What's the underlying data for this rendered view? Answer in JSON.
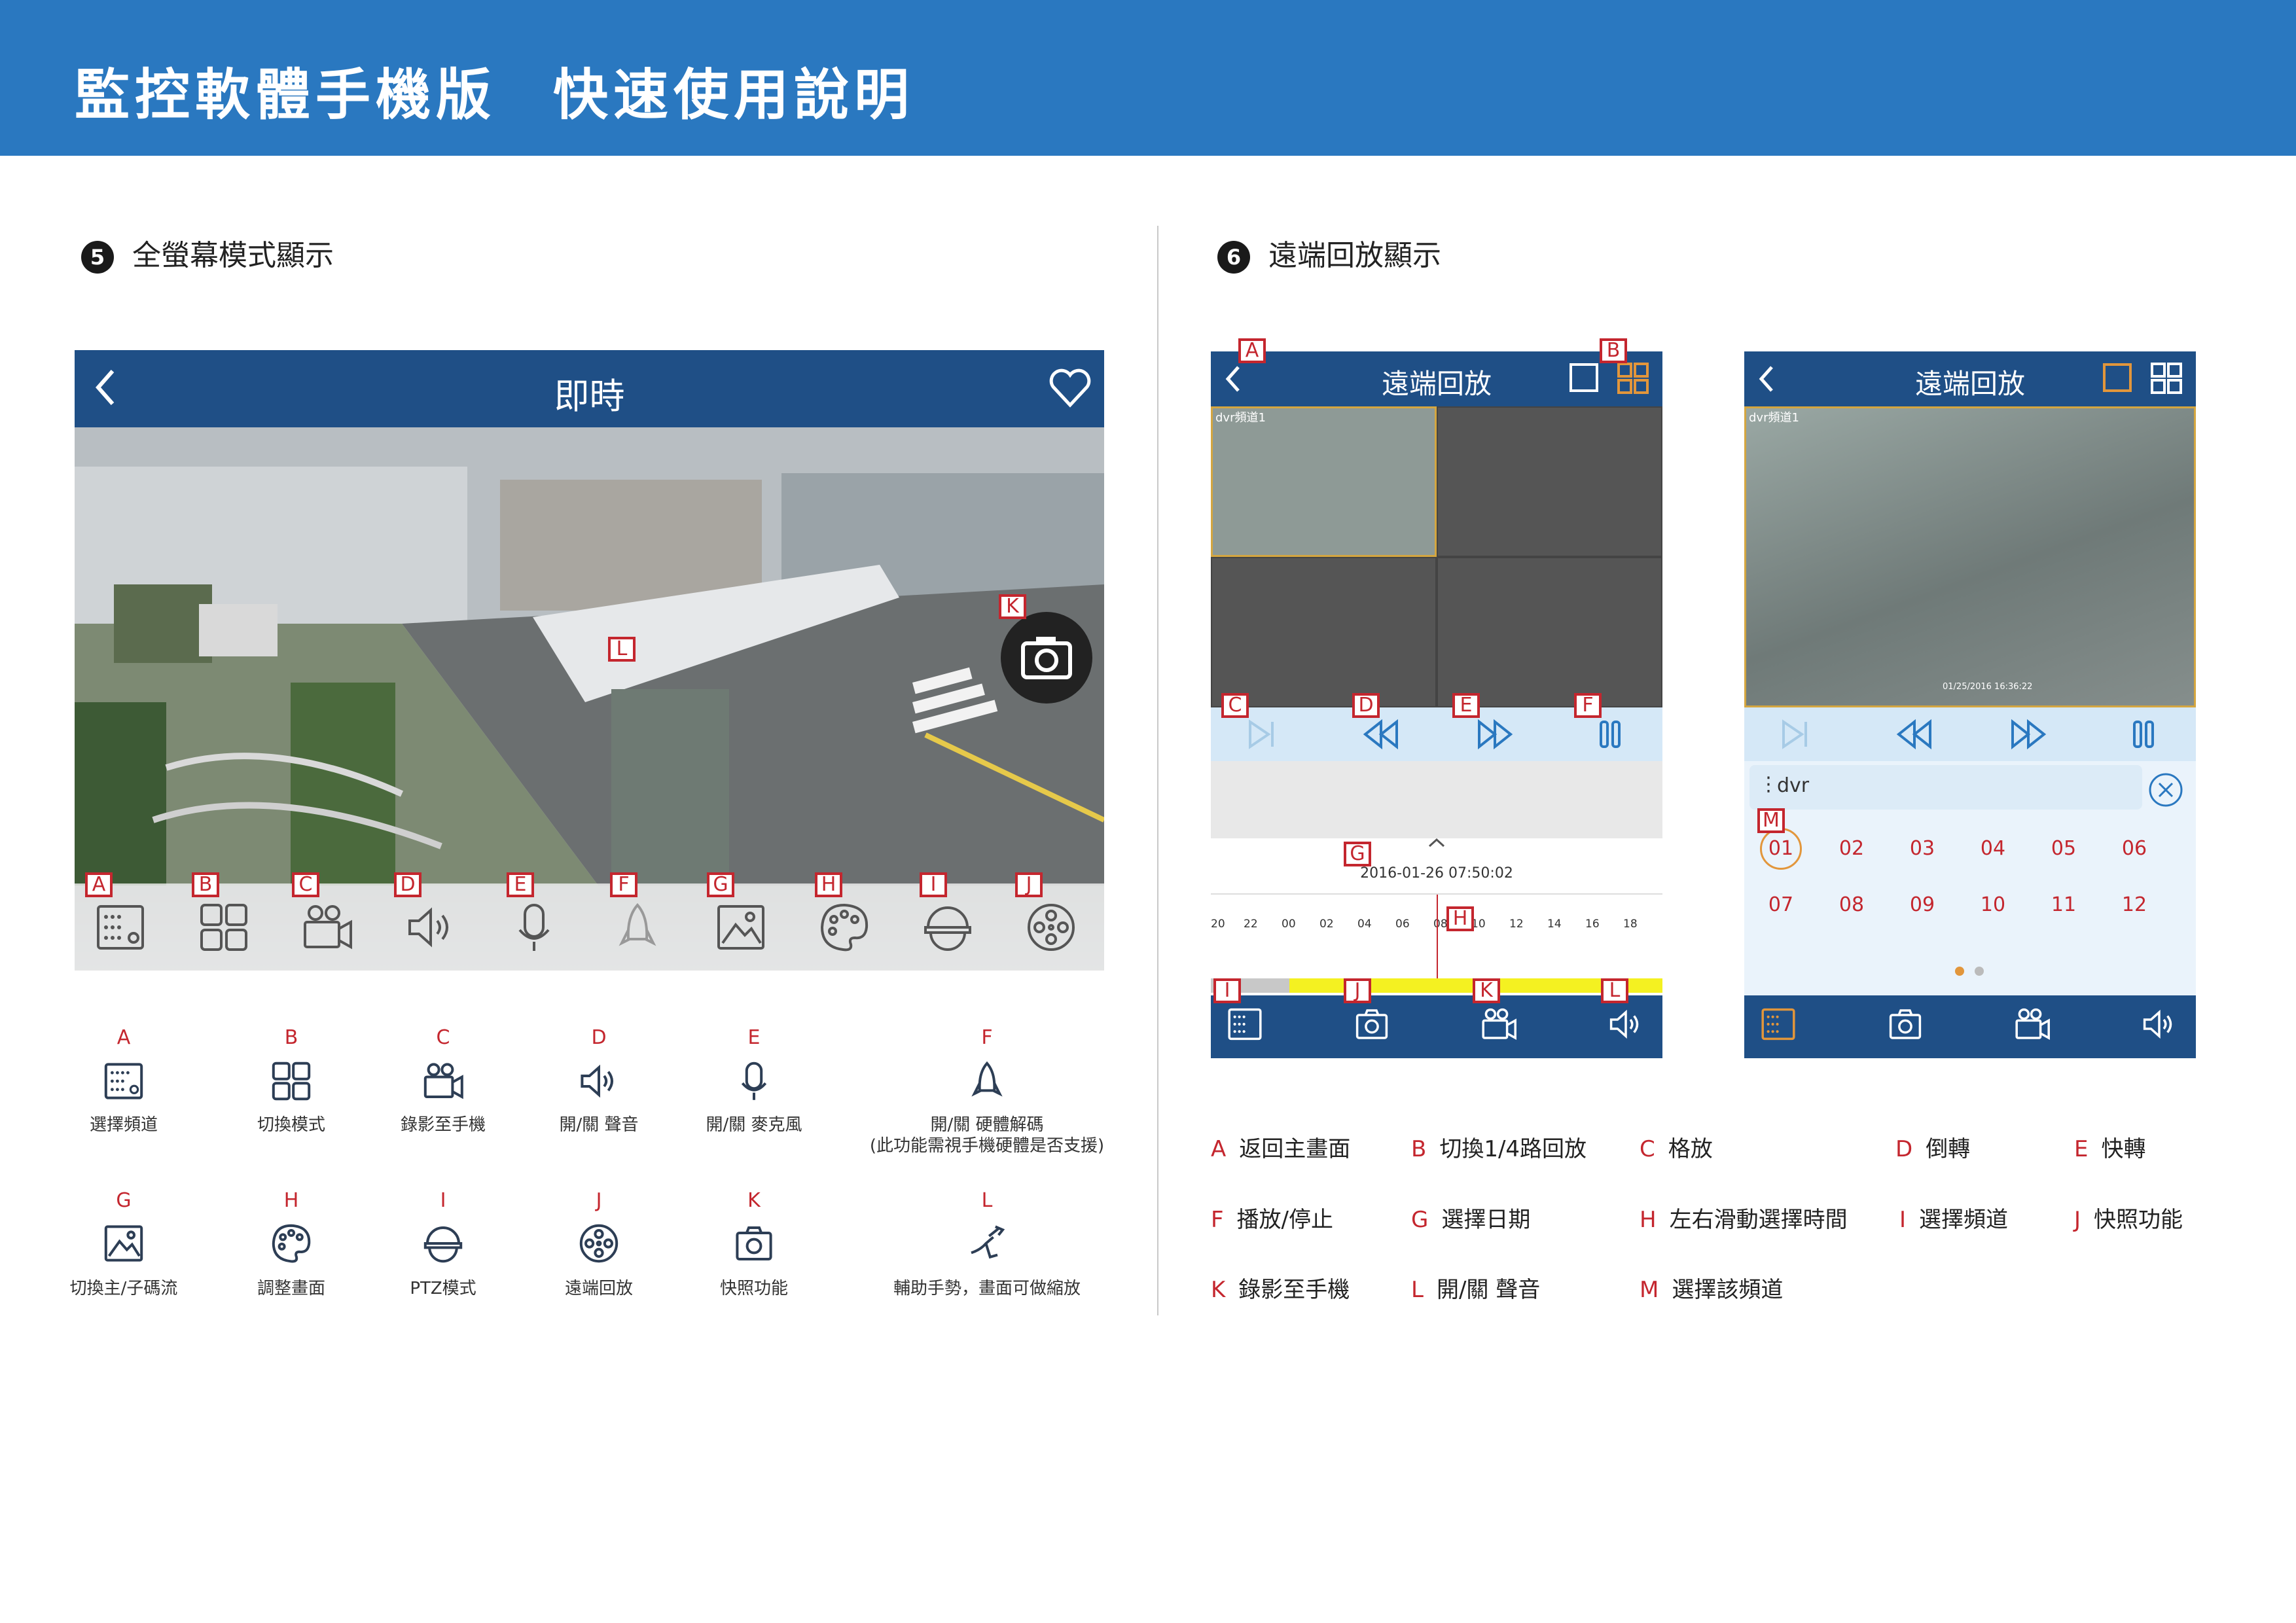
{
  "header": {
    "title_left": "監控軟體手機版",
    "title_right": "快速使用說明"
  },
  "section5": {
    "num": "5",
    "title": "全螢幕模式顯示"
  },
  "section6": {
    "num": "6",
    "title": "遠端回放顯示"
  },
  "colors": {
    "banner": "#2a78c0",
    "app_bar": "#1f4f86",
    "marker": "#c4262e"
  },
  "live_view": {
    "title": "即時",
    "markers": [
      "A",
      "B",
      "C",
      "D",
      "E",
      "F",
      "G",
      "H",
      "I",
      "J"
    ],
    "marker_k": "K",
    "marker_l": "L",
    "icons": [
      "channel-list-icon",
      "grid-icon",
      "video-camera-icon",
      "speaker-icon",
      "microphone-icon",
      "rocket-icon",
      "image-icon",
      "palette-icon",
      "ptz-dome-icon",
      "film-reel-icon"
    ]
  },
  "legend5": [
    {
      "letter": "A",
      "icon": "channel-list-icon",
      "text": "選擇頻道"
    },
    {
      "letter": "B",
      "icon": "grid-icon",
      "text": "切換模式"
    },
    {
      "letter": "C",
      "icon": "video-camera-icon",
      "text": "錄影至手機"
    },
    {
      "letter": "D",
      "icon": "speaker-icon",
      "text": "開/關 聲音"
    },
    {
      "letter": "E",
      "icon": "microphone-icon",
      "text": "開/關 麥克風"
    },
    {
      "letter": "F",
      "icon": "rocket-icon",
      "text": "開/關 硬體解碼",
      "text2": "(此功能需視手機硬體是否支援)"
    },
    {
      "letter": "G",
      "icon": "image-icon",
      "text": "切換主/子碼流"
    },
    {
      "letter": "H",
      "icon": "palette-icon",
      "text": "調整畫面"
    },
    {
      "letter": "I",
      "icon": "ptz-dome-icon",
      "text": "PTZ模式"
    },
    {
      "letter": "J",
      "icon": "film-reel-icon",
      "text": "遠端回放"
    },
    {
      "letter": "K",
      "icon": "camera-icon",
      "text": "快照功能"
    },
    {
      "letter": "L",
      "icon": "gesture-icon",
      "text": "輔助手勢，畫面可做縮放"
    }
  ],
  "playback": {
    "title": "遠端回放",
    "channel_label": "dvr頻道1",
    "date": "2016-01-26 07:50:02",
    "timeline_ticks": [
      "20",
      "22",
      "00",
      "02",
      "04",
      "06",
      "08",
      "10",
      "12",
      "14",
      "16",
      "18"
    ],
    "markers": {
      "A": "A",
      "B": "B",
      "C": "C",
      "D": "D",
      "E": "E",
      "F": "F",
      "G": "G",
      "H": "H",
      "I": "I",
      "J": "J",
      "K": "K",
      "L": "L"
    }
  },
  "playback2": {
    "title": "遠端回放",
    "channel_label": "dvr頻道1",
    "overlay_time": "01/25/2016 16:36:22",
    "device": "dvr",
    "marker_m": "M",
    "channels": [
      "01",
      "02",
      "03",
      "04",
      "05",
      "06",
      "07",
      "08",
      "09",
      "10",
      "11",
      "12"
    ]
  },
  "legend6": [
    {
      "letter": "A",
      "text": "返回主畫面"
    },
    {
      "letter": "B",
      "text": "切換1/4路回放"
    },
    {
      "letter": "C",
      "text": "格放"
    },
    {
      "letter": "D",
      "text": "倒轉"
    },
    {
      "letter": "E",
      "text": "快轉"
    },
    {
      "letter": "F",
      "text": "播放/停止"
    },
    {
      "letter": "G",
      "text": "選擇日期"
    },
    {
      "letter": "H",
      "text": "左右滑動選擇時間"
    },
    {
      "letter": "I",
      "text": "選擇頻道"
    },
    {
      "letter": "J",
      "text": "快照功能"
    },
    {
      "letter": "K",
      "text": "錄影至手機"
    },
    {
      "letter": "L",
      "text": "開/關 聲音"
    },
    {
      "letter": "M",
      "text": "選擇該頻道"
    }
  ]
}
